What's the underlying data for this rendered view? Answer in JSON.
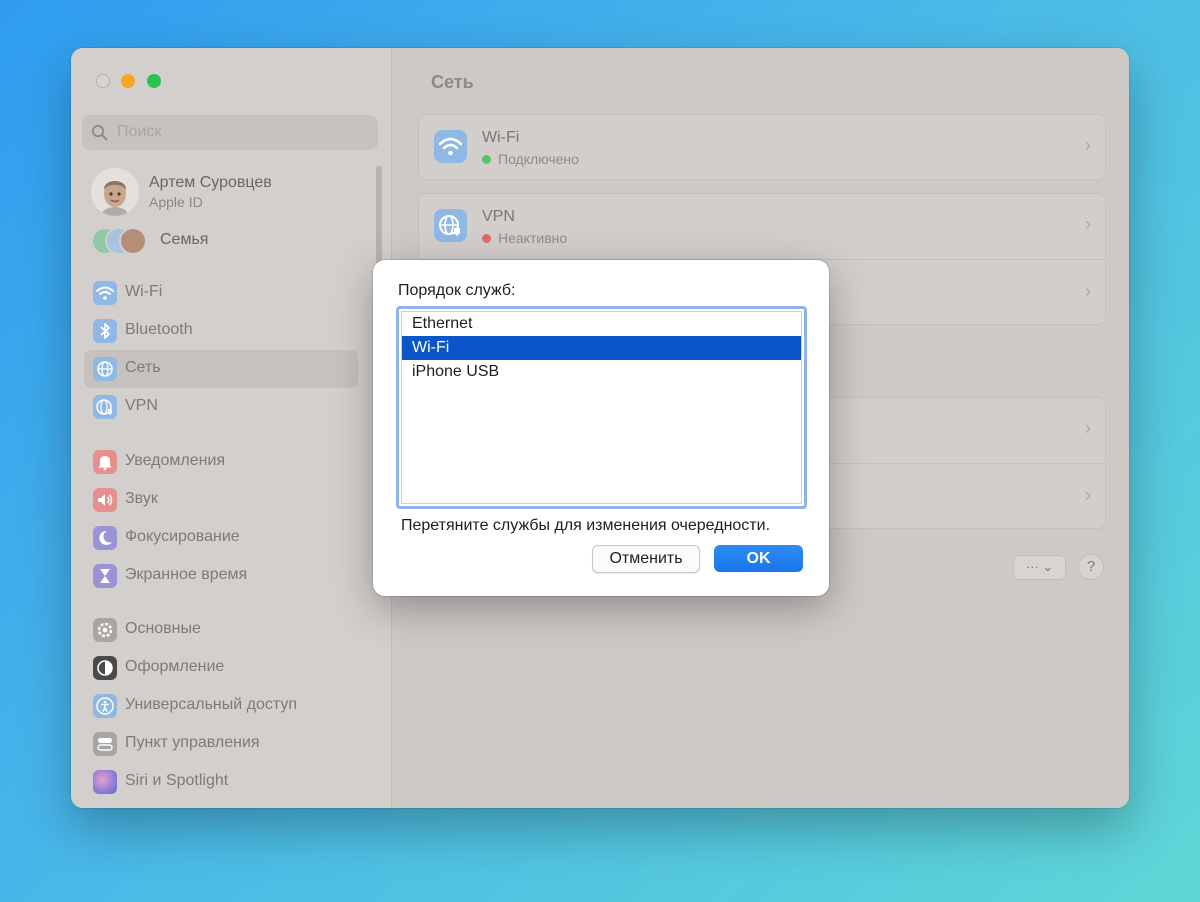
{
  "sidebar": {
    "search_placeholder": "Поиск",
    "user": {
      "name": "Артем Суровцев",
      "subtitle": "Apple ID"
    },
    "family_label": "Семья",
    "items": [
      {
        "label": "Wi-Fi",
        "icon": "wifi-icon",
        "color": "#8fb8e4"
      },
      {
        "label": "Bluetooth",
        "icon": "bluetooth-icon",
        "color": "#8fb8e4"
      },
      {
        "label": "Сеть",
        "icon": "globe-icon",
        "color": "#8fb8e4",
        "selected": true
      },
      {
        "label": "VPN",
        "icon": "vpn-globe-icon",
        "color": "#8fb8e4"
      },
      {
        "label": "Уведомления",
        "icon": "bell-icon",
        "color": "#e58f8f"
      },
      {
        "label": "Звук",
        "icon": "speaker-icon",
        "color": "#e58f8f"
      },
      {
        "label": "Фокусирование",
        "icon": "moon-icon",
        "color": "#9a93d6"
      },
      {
        "label": "Экранное время",
        "icon": "hourglass-icon",
        "color": "#9a93d6"
      },
      {
        "label": "Основные",
        "icon": "gear-icon",
        "color": "#a9a5a3"
      },
      {
        "label": "Оформление",
        "icon": "appearance-icon",
        "color": "#4a4a4a"
      },
      {
        "label": "Универсальный доступ",
        "icon": "accessibility-icon",
        "color": "#8fb8e4"
      },
      {
        "label": "Пункт управления",
        "icon": "control-center-icon",
        "color": "#a9a5a3"
      },
      {
        "label": "Siri и Spotlight",
        "icon": "siri-icon",
        "color": "#a58fd6"
      }
    ]
  },
  "main": {
    "title": "Сеть",
    "services": [
      {
        "name": "Wi-Fi",
        "status": "Подключено",
        "status_color": "#5cc26a"
      },
      {
        "name": "VPN",
        "status": "Неактивно",
        "status_color": "#e06a6a"
      }
    ],
    "more_label": "··· ⌄",
    "help_label": "?"
  },
  "dialog": {
    "label": "Порядок служб:",
    "items": [
      "Ethernet",
      "Wi-Fi",
      "iPhone USB"
    ],
    "selected": "Wi-Fi",
    "hint": "Перетяните службы для изменения очередности.",
    "cancel_label": "Отменить",
    "ok_label": "OK"
  }
}
